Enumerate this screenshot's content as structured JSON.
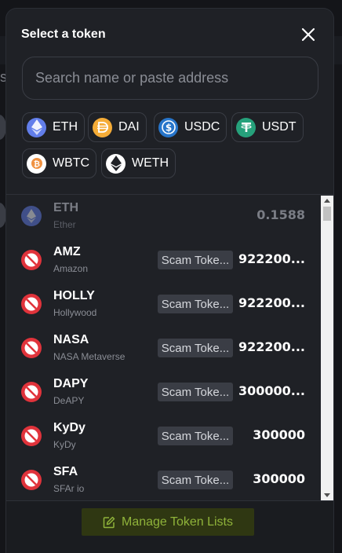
{
  "modal": {
    "title": "Select a token",
    "close_icon": "close-icon"
  },
  "search": {
    "placeholder": "Search name or paste address",
    "value": ""
  },
  "common_tokens": [
    {
      "symbol": "ETH",
      "icon": "eth-icon",
      "color": "#627eea"
    },
    {
      "symbol": "DAI",
      "icon": "dai-icon",
      "color": "#f5ac37"
    },
    {
      "symbol": "USDC",
      "icon": "usdc-icon",
      "color": "#2775ca"
    },
    {
      "symbol": "USDT",
      "icon": "usdt-icon",
      "color": "#26a17b"
    },
    {
      "symbol": "WBTC",
      "icon": "wbtc-icon",
      "color": "#f09242"
    },
    {
      "symbol": "WETH",
      "icon": "weth-icon",
      "color": "#ffffff"
    }
  ],
  "tokens": [
    {
      "symbol": "ETH",
      "name": "Ether",
      "balance": "0.1588",
      "tag": "",
      "icon": "eth-icon",
      "disabled": true
    },
    {
      "symbol": "AMZ",
      "name": "Amazon",
      "balance": "922200...",
      "tag": "Scam Toke...",
      "icon": "blocked-icon"
    },
    {
      "symbol": "HOLLY",
      "name": "Hollywood",
      "balance": "922200...",
      "tag": "Scam Toke...",
      "icon": "blocked-icon"
    },
    {
      "symbol": "NASA",
      "name": "NASA Metaverse",
      "balance": "922200...",
      "tag": "Scam Toke...",
      "icon": "blocked-icon"
    },
    {
      "symbol": "DAPY",
      "name": "DeAPY",
      "balance": "300000...",
      "tag": "Scam Toke...",
      "icon": "blocked-icon"
    },
    {
      "symbol": "KyDy",
      "name": "KyDy",
      "balance": "300000",
      "tag": "Scam Toke...",
      "icon": "blocked-icon"
    },
    {
      "symbol": "SFA",
      "name": "SFAr io",
      "balance": "300000",
      "tag": "Scam Toke...",
      "icon": "blocked-icon"
    }
  ],
  "footer": {
    "manage_label": "Manage Token Lists",
    "manage_icon": "edit-icon"
  },
  "colors": {
    "accent": "#8fb33a",
    "scam_icon": "#e0333b",
    "modal_bg": "#1f2126"
  }
}
